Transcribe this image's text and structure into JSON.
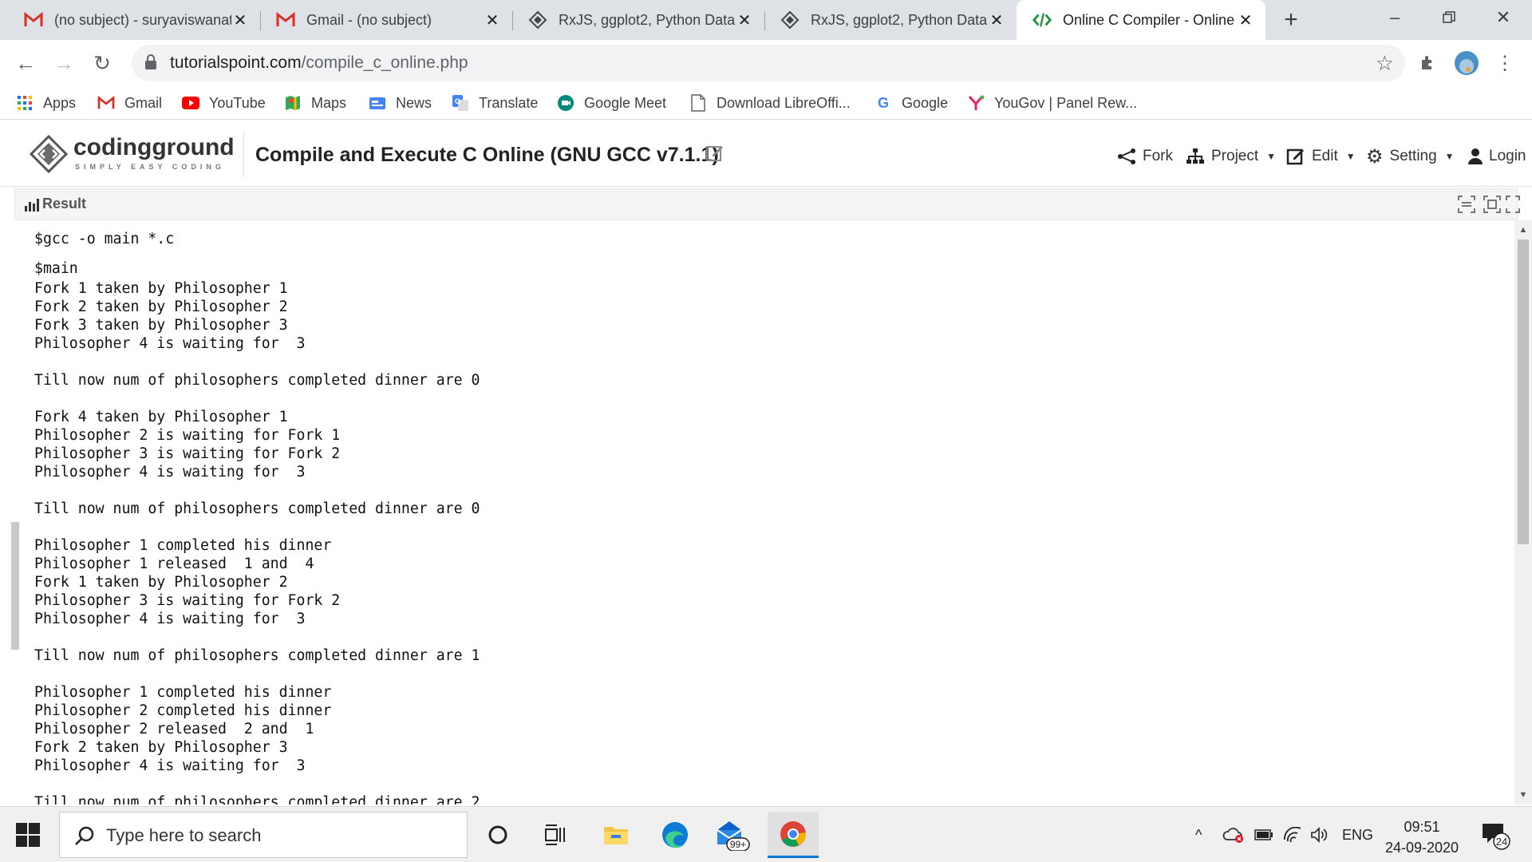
{
  "tabs": [
    {
      "title": "(no subject) - suryaviswanat",
      "icon": "gmail-icon"
    },
    {
      "title": "Gmail - (no subject)",
      "icon": "gmail-icon"
    },
    {
      "title": "RxJS, ggplot2, Python Data",
      "icon": "tutorialspoint-icon"
    },
    {
      "title": "RxJS, ggplot2, Python Data",
      "icon": "tutorialspoint-icon"
    },
    {
      "title": "Online C Compiler - Online",
      "icon": "code-icon"
    }
  ],
  "address": {
    "domain": "tutorialspoint.com",
    "path": "/compile_c_online.php"
  },
  "bookmarks": [
    {
      "label": "Apps",
      "icon": "apps-grid-icon"
    },
    {
      "label": "Gmail",
      "icon": "gmail-icon"
    },
    {
      "label": "YouTube",
      "icon": "youtube-icon"
    },
    {
      "label": "Maps",
      "icon": "maps-icon"
    },
    {
      "label": "News",
      "icon": "news-icon"
    },
    {
      "label": "Translate",
      "icon": "translate-icon"
    },
    {
      "label": "Google Meet",
      "icon": "google-meet-icon"
    },
    {
      "label": "Download LibreOffi...",
      "icon": "page-icon"
    },
    {
      "label": "Google",
      "icon": "google-icon"
    },
    {
      "label": "YouGov | Panel Rew...",
      "icon": "yougov-icon"
    }
  ],
  "site": {
    "logo_word": "codingground",
    "logo_tagline": "SIMPLY EASY CODING",
    "title": "Compile and Execute C Online (GNU GCC v7.1.1)",
    "menu": {
      "fork": "Fork",
      "project": "Project",
      "edit": "Edit",
      "setting": "Setting",
      "login": "Login"
    }
  },
  "result": {
    "label": "Result",
    "command1": "$gcc -o main *.c",
    "command2": "$main",
    "output": "Fork 1 taken by Philosopher 1\nFork 2 taken by Philosopher 2\nFork 3 taken by Philosopher 3\nPhilosopher 4 is waiting for  3\n\nTill now num of philosophers completed dinner are 0\n\nFork 4 taken by Philosopher 1\nPhilosopher 2 is waiting for Fork 1\nPhilosopher 3 is waiting for Fork 2\nPhilosopher 4 is waiting for  3\n\nTill now num of philosophers completed dinner are 0\n\nPhilosopher 1 completed his dinner\nPhilosopher 1 released  1 and  4\nFork 1 taken by Philosopher 2\nPhilosopher 3 is waiting for Fork 2\nPhilosopher 4 is waiting for  3\n\nTill now num of philosophers completed dinner are 1\n\nPhilosopher 1 completed his dinner\nPhilosopher 2 completed his dinner\nPhilosopher 2 released  2 and  1\nFork 2 taken by Philosopher 3\nPhilosopher 4 is waiting for  3\n\nTill now num of philosophers completed dinner are 2"
  },
  "taskbar": {
    "search_placeholder": "Type here to search",
    "mail_badge": "99+",
    "lang": "ENG",
    "time": "09:51",
    "date": "24-09-2020",
    "notif_count": "24"
  },
  "colors": {
    "accent": "#0078d7",
    "chrome_bg": "#dee1e6",
    "page_bg": "#ffffff"
  }
}
